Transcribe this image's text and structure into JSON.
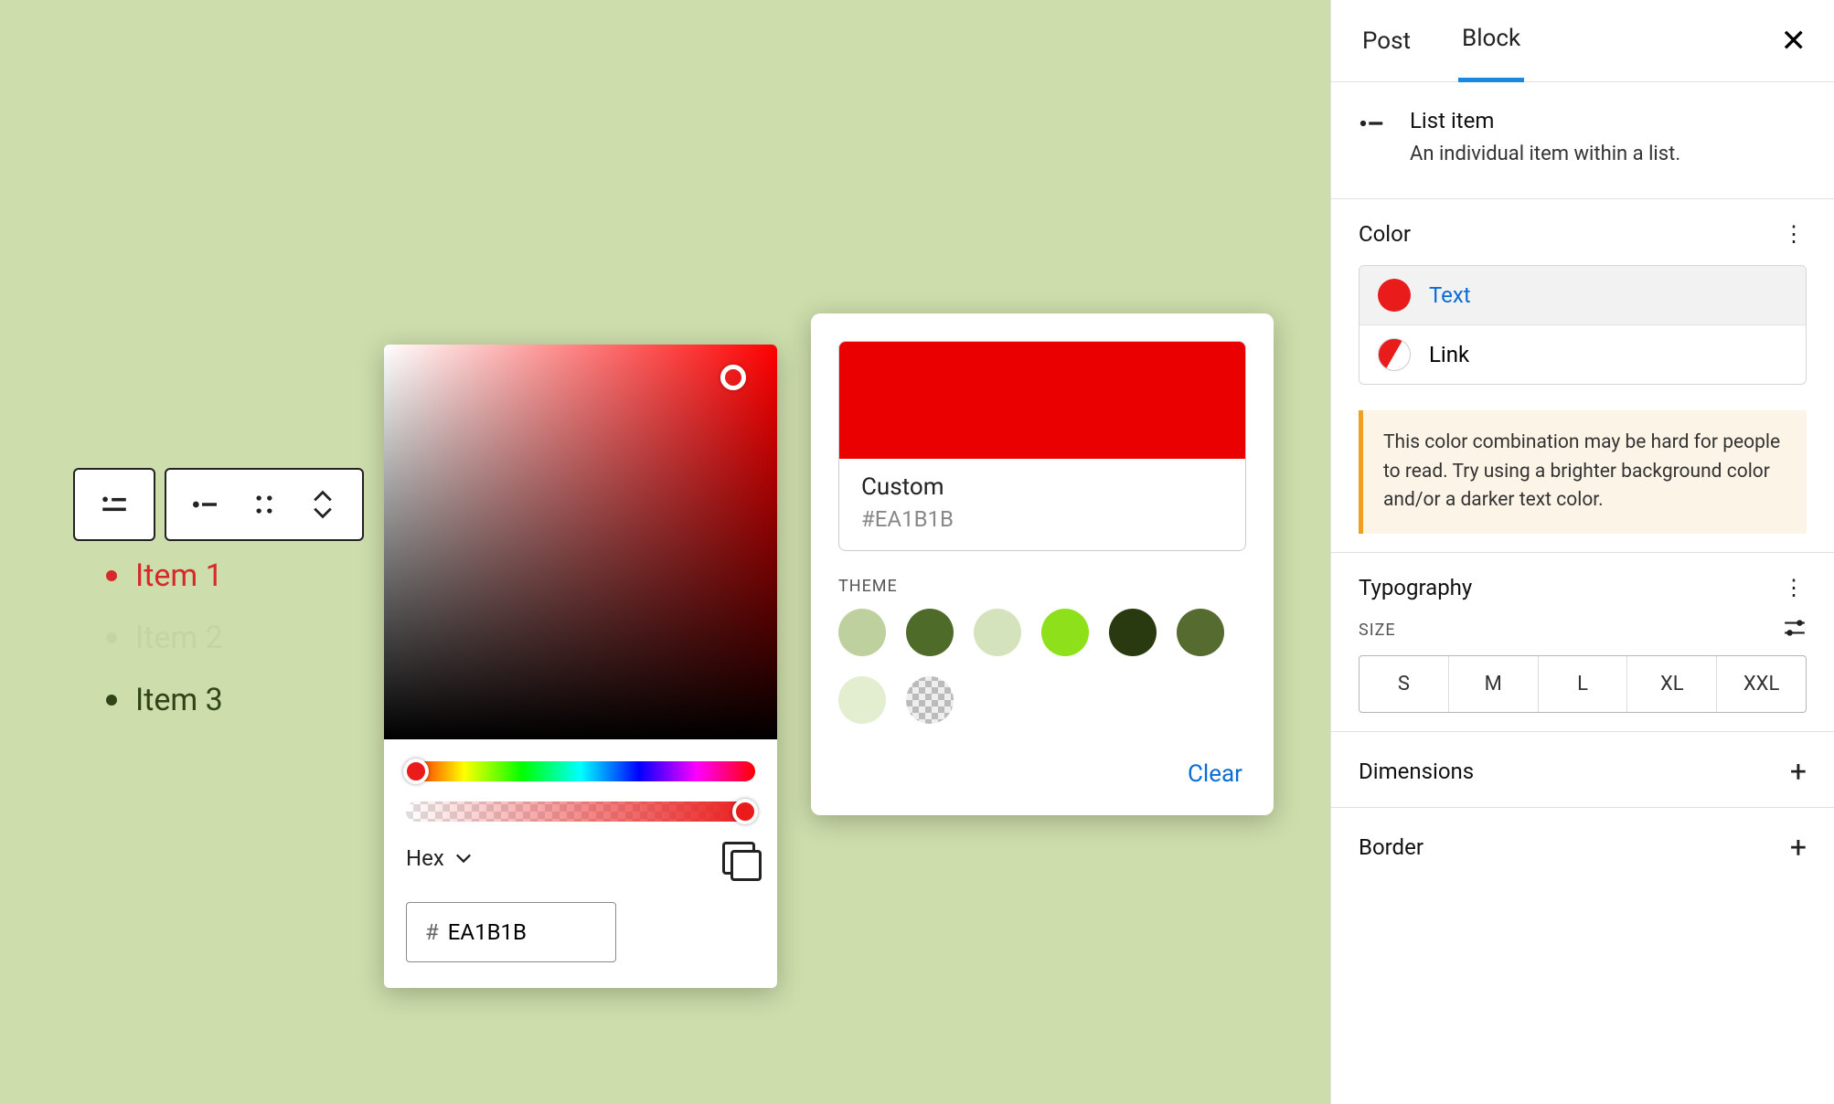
{
  "canvas": {
    "background": "#cdddab",
    "list": [
      {
        "label": "Item 1",
        "text_color": "#d42a2a",
        "bullet_color": "#d42a2a"
      },
      {
        "label": "Item 2",
        "text_color": "#c4d4a3",
        "bullet_color": "#c4d4a3"
      },
      {
        "label": "Item 3",
        "text_color": "#304417",
        "bullet_color": "#304417"
      }
    ]
  },
  "toolbar": {
    "buttons": [
      "list-item-icon",
      "indent-icon",
      "drag-handle-icon",
      "move-up-down-icon"
    ]
  },
  "color_picker": {
    "format": "Hex",
    "hex_prefix": "#",
    "hex_value": "EA1B1B",
    "current_color": "#EA1B1B"
  },
  "swatch_panel": {
    "preview_color": "#EA0000",
    "swatch_name": "Custom",
    "swatch_hex": "#EA1B1B",
    "theme_label": "THEME",
    "theme_colors": [
      "#bdd09d",
      "#4f6b2a",
      "#d5e3bd",
      "#8de01a",
      "#2a3a10",
      "#556b2f",
      "#e3edd0"
    ],
    "clear_label": "Clear"
  },
  "sidebar": {
    "tabs": {
      "post": "Post",
      "block": "Block",
      "active": "Block"
    },
    "block": {
      "name": "List item",
      "description": "An individual item within a list."
    },
    "color": {
      "label": "Color",
      "rows": [
        {
          "key": "text",
          "label": "Text",
          "color": "#ea1b1b",
          "active": true
        },
        {
          "key": "link",
          "label": "Link",
          "split": true
        }
      ],
      "warning": "This color combination may be hard for people to read. Try using a brighter background color and/or a darker text color."
    },
    "typography": {
      "label": "Typography",
      "size_label": "SIZE",
      "sizes": [
        "S",
        "M",
        "L",
        "XL",
        "XXL"
      ]
    },
    "dimensions": {
      "label": "Dimensions"
    },
    "border": {
      "label": "Border"
    }
  }
}
